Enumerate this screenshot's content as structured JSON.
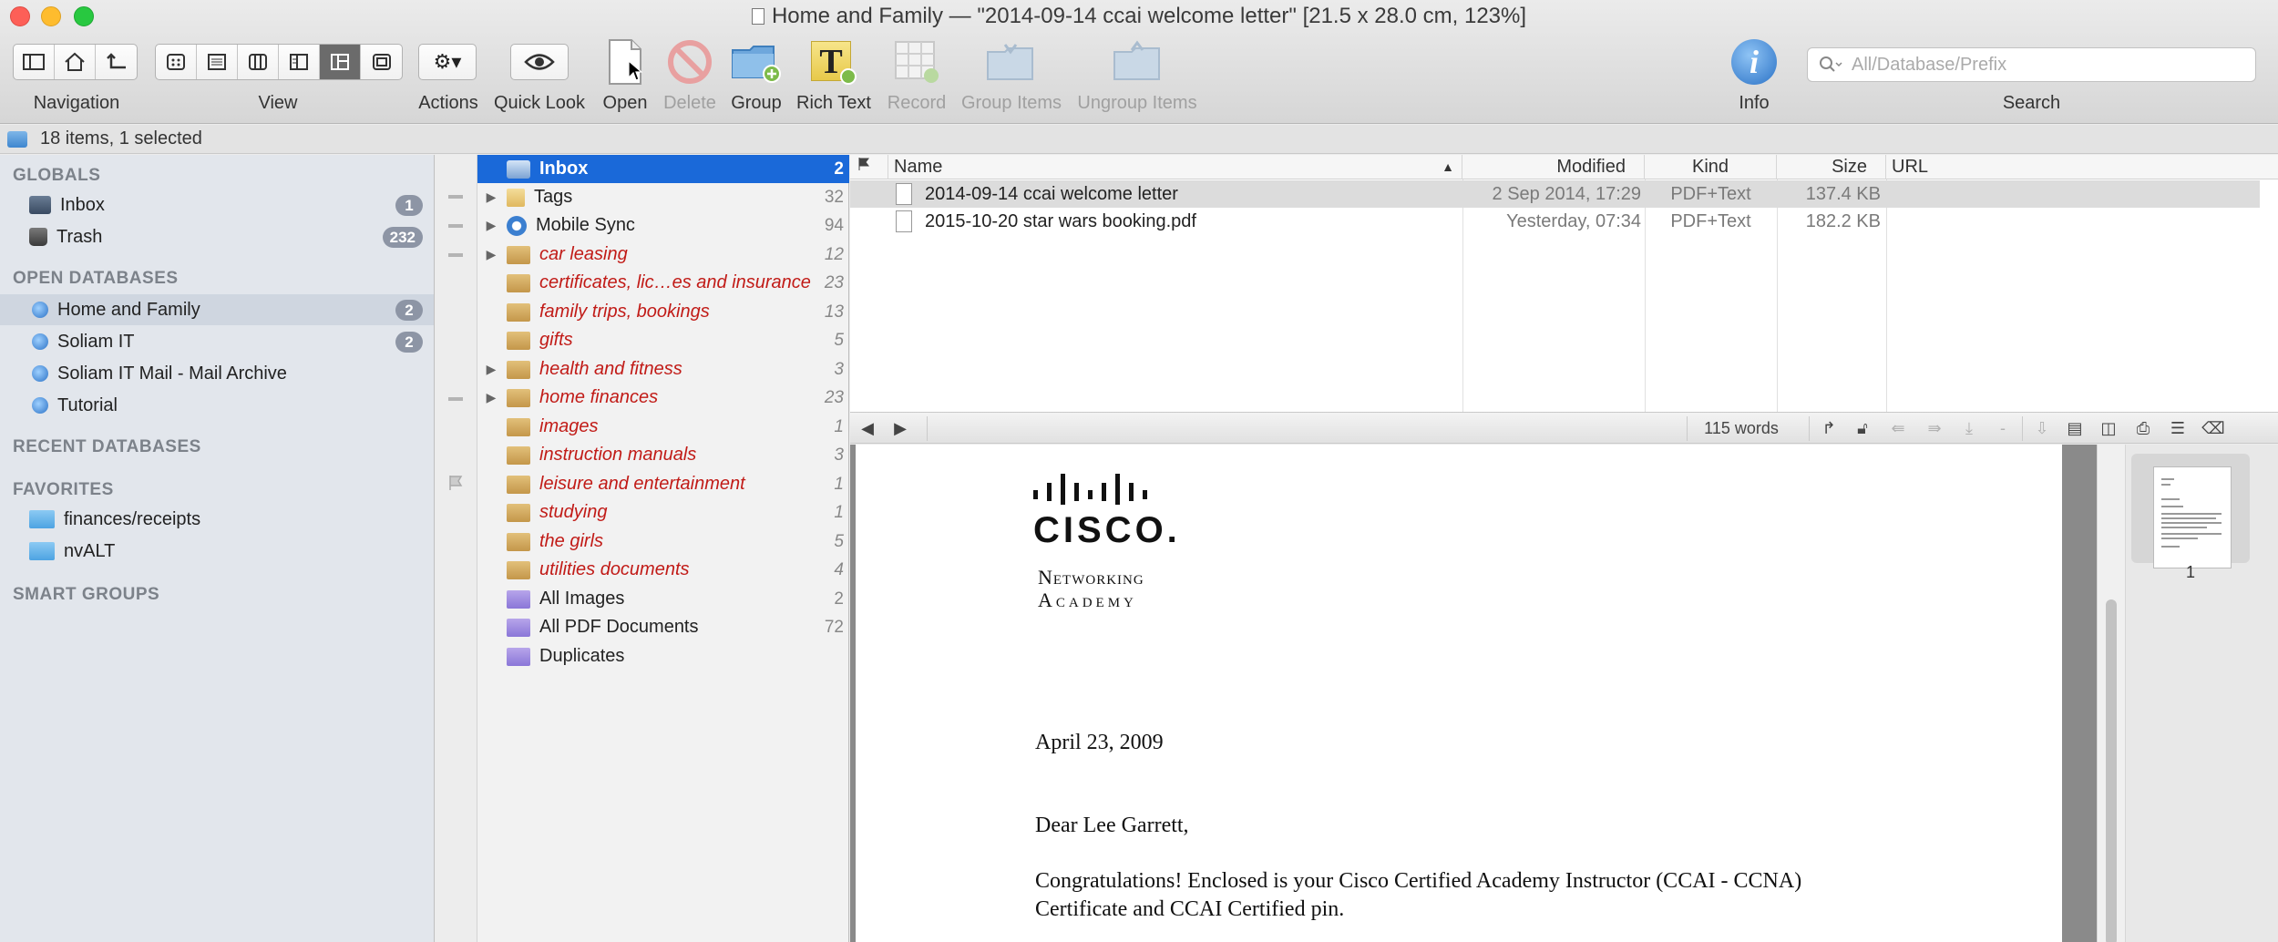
{
  "window": {
    "title": "Home and Family — \"2014-09-14 ccai welcome letter\" [21.5 x 28.0 cm, 123%]"
  },
  "toolbar": {
    "navigation_label": "Navigation",
    "view_label": "View",
    "actions_label": "Actions",
    "quicklook_label": "Quick Look",
    "open_label": "Open",
    "delete_label": "Delete",
    "group_label": "Group",
    "richtext_label": "Rich Text",
    "record_label": "Record",
    "groupitems_label": "Group Items",
    "ungroupitems_label": "Ungroup Items",
    "info_label": "Info",
    "search_label": "Search",
    "search_placeholder": "All/Database/Prefix",
    "richtext_glyph": "T",
    "info_glyph": "i"
  },
  "status": {
    "text": "18 items, 1 selected"
  },
  "sidebar": {
    "globals_heading": "GLOBALS",
    "globals": [
      {
        "label": "Inbox",
        "badge": "1"
      },
      {
        "label": "Trash",
        "badge": "232"
      }
    ],
    "open_heading": "OPEN DATABASES",
    "databases": [
      {
        "label": "Home and Family",
        "badge": "2"
      },
      {
        "label": "Soliam IT",
        "badge": "2"
      },
      {
        "label": "Soliam IT Mail - Mail Archive",
        "badge": ""
      },
      {
        "label": "Tutorial",
        "badge": ""
      }
    ],
    "recent_heading": "RECENT DATABASES",
    "favorites_heading": "FAVORITES",
    "favorites": [
      {
        "label": "finances/receipts"
      },
      {
        "label": "nvALT"
      }
    ],
    "smart_heading": "SMART GROUPS"
  },
  "groups": [
    {
      "name": "Inbox",
      "count": "2"
    },
    {
      "name": "Tags",
      "count": "32"
    },
    {
      "name": "Mobile Sync",
      "count": "94"
    },
    {
      "name": "car leasing",
      "count": "12"
    },
    {
      "name": "certificates, lic…es and insurance",
      "count": "23"
    },
    {
      "name": "family trips, bookings",
      "count": "13"
    },
    {
      "name": "gifts",
      "count": "5"
    },
    {
      "name": "health and fitness",
      "count": "3"
    },
    {
      "name": "home finances",
      "count": "23"
    },
    {
      "name": "images",
      "count": "1"
    },
    {
      "name": "instruction manuals",
      "count": "3"
    },
    {
      "name": "leisure and entertainment",
      "count": "1"
    },
    {
      "name": "studying",
      "count": "1"
    },
    {
      "name": "the girls",
      "count": "5"
    },
    {
      "name": "utilities documents",
      "count": "4"
    },
    {
      "name": "All Images",
      "count": "2"
    },
    {
      "name": "All PDF Documents",
      "count": "72"
    },
    {
      "name": "Duplicates",
      "count": ""
    }
  ],
  "doclist": {
    "columns": {
      "name": "Name",
      "modified": "Modified",
      "kind": "Kind",
      "size": "Size",
      "url": "URL"
    },
    "rows": [
      {
        "name": "2014-09-14 ccai welcome letter",
        "modified": "2 Sep 2014, 17:29",
        "kind": "PDF+Text",
        "size": "137.4 KB"
      },
      {
        "name": "2015-10-20 star wars booking.pdf",
        "modified": "Yesterday, 07:34",
        "kind": "PDF+Text",
        "size": "182.2 KB"
      }
    ]
  },
  "viewbar": {
    "word_count": "115 words",
    "minus": "-"
  },
  "document": {
    "logo_word": "CISCO.",
    "logo_line1": "Networking",
    "logo_line2": "Academy",
    "date": "April 23, 2009",
    "salutation": "Dear Lee Garrett,",
    "body_line1": "Congratulations!  Enclosed is your Cisco Certified Academy Instructor (CCAI - CCNA)",
    "body_line2": "Certificate and CCAI Certified pin."
  },
  "thumbnails": {
    "page_number": "1"
  }
}
